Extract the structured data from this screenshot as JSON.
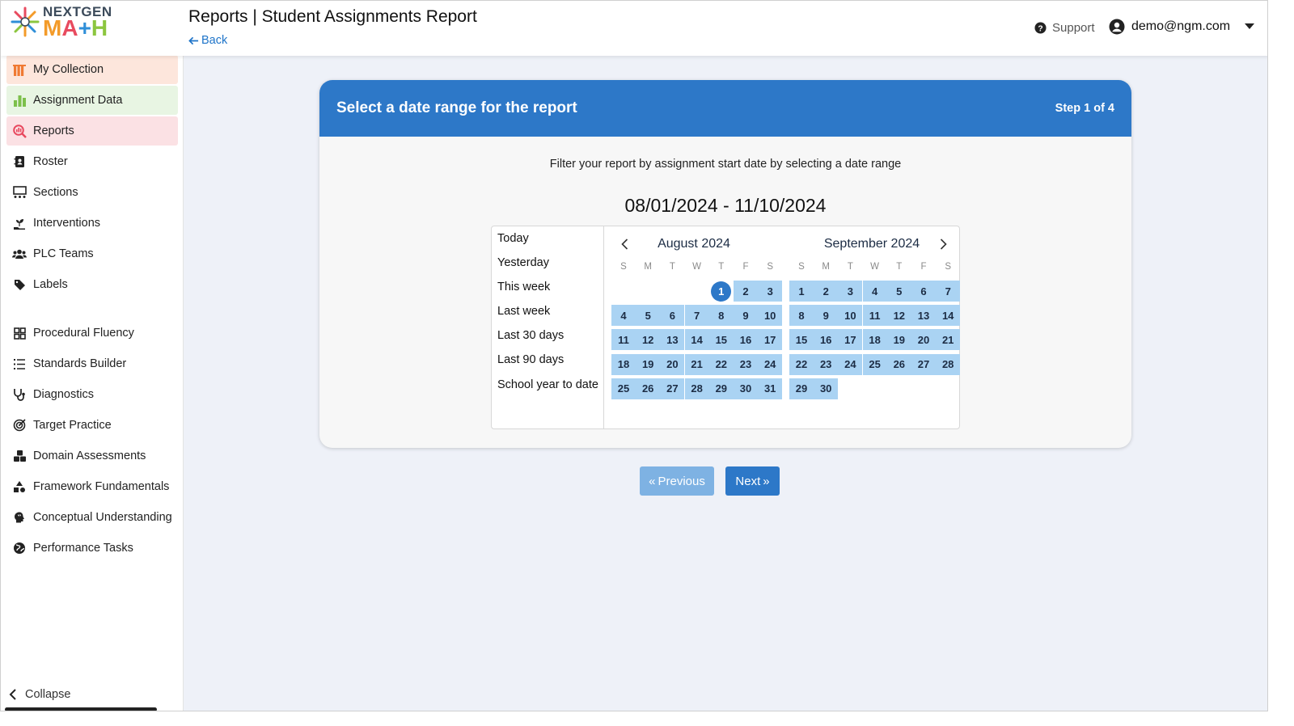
{
  "header": {
    "logo_top": "NEXTGEN",
    "logo_bottom": [
      "M",
      "A",
      "+",
      "H"
    ],
    "page_title": "Reports | Student Assignments Report",
    "back_label": "Back",
    "support_label": "Support",
    "user_email": "demo@ngm.com"
  },
  "sidebar": {
    "items": [
      {
        "label": "My Collection",
        "icon": "books-icon"
      },
      {
        "label": "Assignment Data",
        "icon": "bar-chart-icon"
      },
      {
        "label": "Reports",
        "icon": "magnify-chart-icon"
      },
      {
        "label": "Roster",
        "icon": "contact-book-icon"
      },
      {
        "label": "Sections",
        "icon": "sections-icon"
      },
      {
        "label": "Interventions",
        "icon": "hand-plant-icon"
      },
      {
        "label": "PLC Teams",
        "icon": "users-icon"
      },
      {
        "label": "Labels",
        "icon": "tag-icon"
      },
      {
        "label": "Procedural Fluency",
        "icon": "grid-icon"
      },
      {
        "label": "Standards Builder",
        "icon": "list-icon"
      },
      {
        "label": "Diagnostics",
        "icon": "stethoscope-icon"
      },
      {
        "label": "Target Practice",
        "icon": "target-icon"
      },
      {
        "label": "Domain Assessments",
        "icon": "cubes-icon"
      },
      {
        "label": "Framework Fundamentals",
        "icon": "shapes-icon"
      },
      {
        "label": "Conceptual Understanding",
        "icon": "brain-icon"
      },
      {
        "label": "Performance Tasks",
        "icon": "globe-icon"
      }
    ],
    "collapse_label": "Collapse"
  },
  "card": {
    "title": "Select a date range for the report",
    "step": "Step 1 of 4",
    "filter_text": "Filter your report by assignment start date by selecting a date range",
    "date_range": "08/01/2024 - 11/10/2024"
  },
  "picker": {
    "presets": [
      "Today",
      "Yesterday",
      "This week",
      "Last week",
      "Last 30 days",
      "Last 90 days",
      "School year to date"
    ],
    "weekdays": [
      "S",
      "M",
      "T",
      "W",
      "T",
      "F",
      "S"
    ],
    "months": [
      {
        "title": "August 2024",
        "first_weekday": 4,
        "days": 31,
        "range_start": 1
      },
      {
        "title": "September 2024",
        "first_weekday": 0,
        "days": 30,
        "range_start": null
      }
    ]
  },
  "buttons": {
    "previous_label": "Previous",
    "next_label": "Next"
  },
  "colors": {
    "primary": "#2d78c8",
    "range_fill": "#aad3f3",
    "previous_disabled": "#7eb2e3"
  }
}
